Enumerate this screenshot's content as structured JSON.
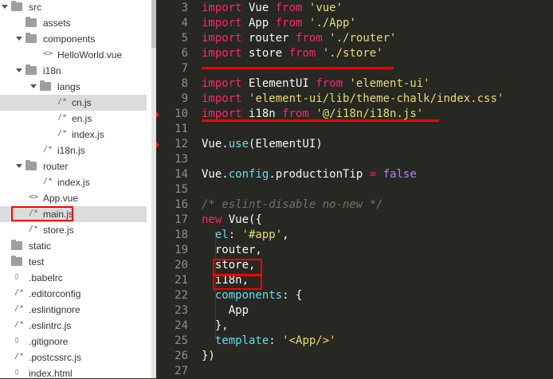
{
  "file_tree": [
    {
      "label": "src",
      "kind": "folder",
      "level": 0,
      "expanded": true
    },
    {
      "label": "assets",
      "kind": "folder",
      "level": 1,
      "expanded": false
    },
    {
      "label": "components",
      "kind": "folder",
      "level": 1,
      "expanded": true
    },
    {
      "label": "HelloWorld.vue",
      "kind": "vue",
      "level": 2
    },
    {
      "label": "i18n",
      "kind": "folder",
      "level": 1,
      "expanded": true
    },
    {
      "label": "langs",
      "kind": "folder",
      "level": 2,
      "expanded": true
    },
    {
      "label": "cn.js",
      "kind": "js",
      "level": 3,
      "selected": true
    },
    {
      "label": "en.js",
      "kind": "js",
      "level": 3
    },
    {
      "label": "index.js",
      "kind": "js",
      "level": 3
    },
    {
      "label": "i18n.js",
      "kind": "js",
      "level": 2
    },
    {
      "label": "router",
      "kind": "folder",
      "level": 1,
      "expanded": true
    },
    {
      "label": "index.js",
      "kind": "js",
      "level": 2
    },
    {
      "label": "App.vue",
      "kind": "vue",
      "level": 1
    },
    {
      "label": "main.js",
      "kind": "js",
      "level": 1,
      "selected": true,
      "boxed": true
    },
    {
      "label": "store.js",
      "kind": "js",
      "level": 1
    },
    {
      "label": "static",
      "kind": "folder",
      "level": 0,
      "expanded": false
    },
    {
      "label": "test",
      "kind": "folder",
      "level": 0,
      "expanded": false
    },
    {
      "label": ".babelrc",
      "kind": "file",
      "level": 0
    },
    {
      "label": ".editorconfig",
      "kind": "js",
      "level": 0
    },
    {
      "label": ".eslintignore",
      "kind": "js",
      "level": 0
    },
    {
      "label": ".eslintrc.js",
      "kind": "js",
      "level": 0
    },
    {
      "label": ".gitignore",
      "kind": "file",
      "level": 0
    },
    {
      "label": ".postcssrc.js",
      "kind": "js",
      "level": 0
    },
    {
      "label": "index.html",
      "kind": "file",
      "level": 0
    }
  ],
  "editor": {
    "lines": [
      {
        "n": "3",
        "tokens": [
          [
            "import",
            "kw"
          ],
          [
            " Vue ",
            "plain"
          ],
          [
            "from",
            "kw"
          ],
          [
            " ",
            "plain"
          ],
          [
            "'vue'",
            "str"
          ]
        ]
      },
      {
        "n": "4",
        "tokens": [
          [
            "import",
            "kw"
          ],
          [
            " App ",
            "plain"
          ],
          [
            "from",
            "kw"
          ],
          [
            " ",
            "plain"
          ],
          [
            "'./App'",
            "str"
          ]
        ]
      },
      {
        "n": "5",
        "tokens": [
          [
            "import",
            "kw"
          ],
          [
            " router ",
            "plain"
          ],
          [
            "from",
            "kw"
          ],
          [
            " ",
            "plain"
          ],
          [
            "'./router'",
            "str"
          ]
        ]
      },
      {
        "n": "6",
        "tokens": [
          [
            "import",
            "kw"
          ],
          [
            " store ",
            "plain"
          ],
          [
            "from",
            "kw"
          ],
          [
            " ",
            "plain"
          ],
          [
            "'./store'",
            "str"
          ]
        ]
      },
      {
        "n": "7",
        "tokens": []
      },
      {
        "n": "8",
        "tokens": [
          [
            "import",
            "kw"
          ],
          [
            " ElementUI ",
            "plain"
          ],
          [
            "from",
            "kw"
          ],
          [
            " ",
            "plain"
          ],
          [
            "'element-ui'",
            "str"
          ]
        ]
      },
      {
        "n": "9",
        "tokens": [
          [
            "import",
            "kw"
          ],
          [
            " ",
            "plain"
          ],
          [
            "'element-ui/lib/theme-chalk/index.css'",
            "str"
          ]
        ]
      },
      {
        "n": "10",
        "tokens": [
          [
            "import",
            "kw"
          ],
          [
            " i18n ",
            "plain"
          ],
          [
            "from",
            "kw"
          ],
          [
            " ",
            "plain"
          ],
          [
            "'@/i18n/i18n.js'",
            "str"
          ]
        ],
        "marker": true
      },
      {
        "n": "11",
        "tokens": []
      },
      {
        "n": "12",
        "tokens": [
          [
            "Vue",
            "plain"
          ],
          [
            ".",
            "plain"
          ],
          [
            "use",
            "fn"
          ],
          [
            "(ElementUI)",
            "plain"
          ]
        ],
        "marker": true
      },
      {
        "n": "13",
        "tokens": []
      },
      {
        "n": "14",
        "tokens": [
          [
            "Vue",
            "plain"
          ],
          [
            ".",
            "plain"
          ],
          [
            "config",
            "fn"
          ],
          [
            ".",
            "plain"
          ],
          [
            "productionTip",
            "plain"
          ],
          [
            " ",
            "plain"
          ],
          [
            "=",
            "kw"
          ],
          [
            " ",
            "plain"
          ],
          [
            "false",
            "con"
          ]
        ]
      },
      {
        "n": "15",
        "tokens": []
      },
      {
        "n": "16",
        "tokens": [
          [
            "/* eslint-disable no-new */",
            "com"
          ]
        ]
      },
      {
        "n": "17",
        "tokens": [
          [
            "new",
            "kw"
          ],
          [
            " ",
            "plain"
          ],
          [
            "Vue",
            "plain"
          ],
          [
            "({",
            "plain"
          ]
        ]
      },
      {
        "n": "18",
        "tokens": [
          [
            "  ",
            "plain"
          ],
          [
            "el",
            "fn"
          ],
          [
            ": ",
            "plain"
          ],
          [
            "'#app'",
            "str"
          ],
          [
            ",",
            "plain"
          ]
        ]
      },
      {
        "n": "19",
        "tokens": [
          [
            "  router,",
            "plain"
          ]
        ]
      },
      {
        "n": "20",
        "tokens": [
          [
            "  store,",
            "plain"
          ]
        ]
      },
      {
        "n": "21",
        "tokens": [
          [
            "  i18n,",
            "plain"
          ]
        ]
      },
      {
        "n": "22",
        "tokens": [
          [
            "  ",
            "plain"
          ],
          [
            "components",
            "fn"
          ],
          [
            ": {",
            "plain"
          ]
        ]
      },
      {
        "n": "23",
        "tokens": [
          [
            "    App",
            "plain"
          ]
        ]
      },
      {
        "n": "24",
        "tokens": [
          [
            "  },",
            "plain"
          ]
        ]
      },
      {
        "n": "25",
        "tokens": [
          [
            "  ",
            "plain"
          ],
          [
            "template",
            "fn"
          ],
          [
            ": ",
            "plain"
          ],
          [
            "'<App/>'",
            "str"
          ]
        ]
      },
      {
        "n": "26",
        "tokens": [
          [
            "})",
            "plain"
          ]
        ]
      },
      {
        "n": "27",
        "tokens": []
      }
    ]
  },
  "colors": {
    "kw": "#f92672",
    "str": "#e6db74",
    "fn": "#66d9ef",
    "con": "#ae81ff",
    "com": "#75715e",
    "plain": "#f8f8f2",
    "annotation": "#ff0000"
  }
}
